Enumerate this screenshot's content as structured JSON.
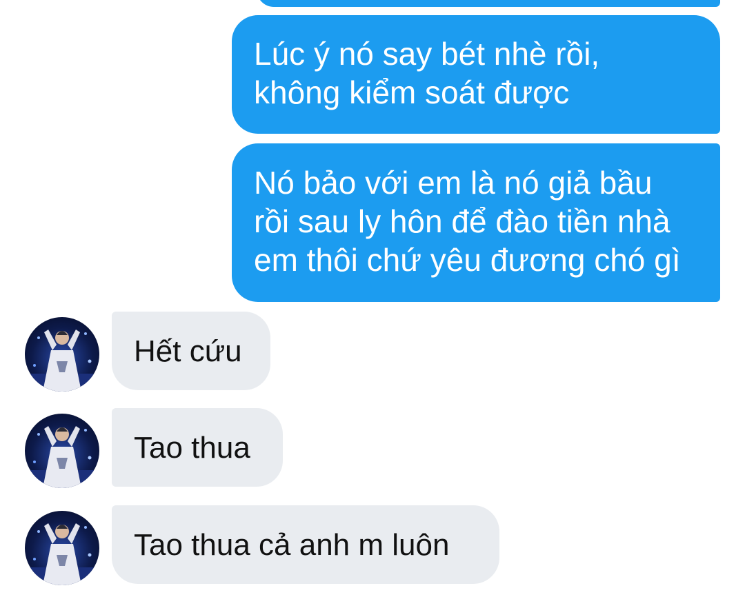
{
  "colors": {
    "outgoing_bubble": "#1c9cf0",
    "incoming_bubble": "#e9ecf0",
    "outgoing_text": "#ffffff",
    "incoming_text": "#111111"
  },
  "outgoing": [
    {
      "lines": [
        "Lúc ý nó say bét nhè rồi,",
        "không kiểm soát được"
      ]
    },
    {
      "lines": [
        "Nó bảo với em là nó giả bầu",
        "rồi sau ly hôn để đào tiền nhà",
        "em thôi chứ yêu đương chó gì"
      ]
    }
  ],
  "incoming": [
    {
      "text": "Hết cứu",
      "avatar_icon": "contact-avatar"
    },
    {
      "text": "Tao thua",
      "avatar_icon": "contact-avatar"
    },
    {
      "text": "Tao thua cả anh m luôn",
      "avatar_icon": "contact-avatar"
    }
  ]
}
